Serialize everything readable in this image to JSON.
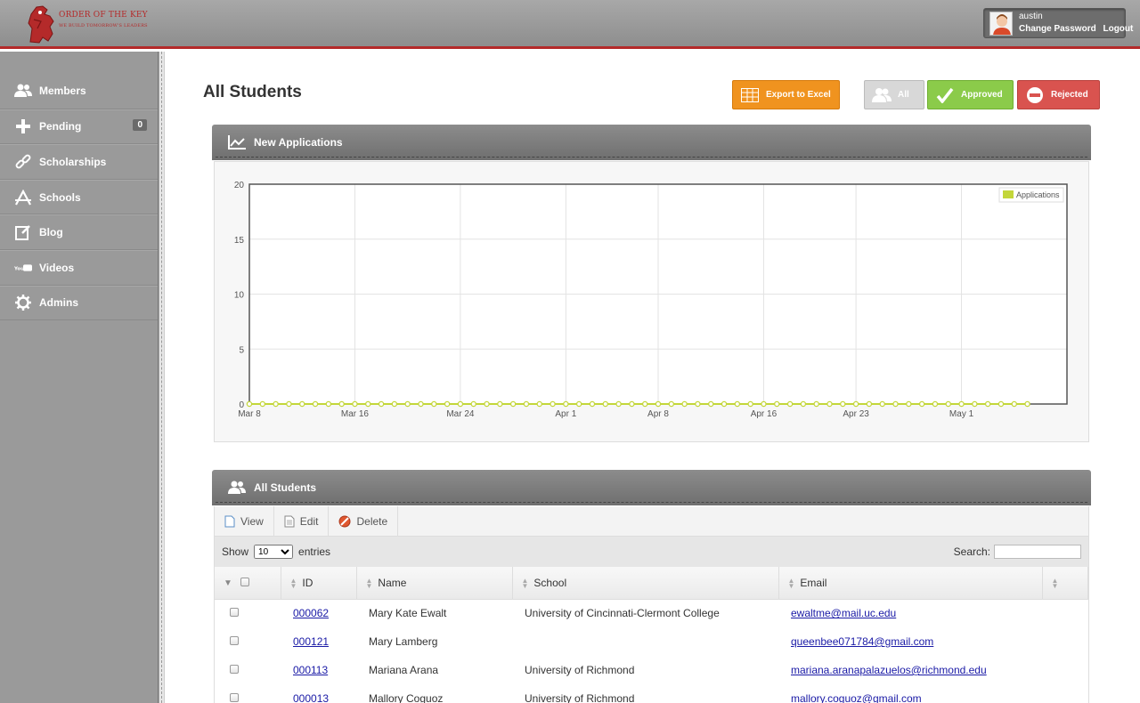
{
  "header": {
    "brand": "ORDER OF THE KEY",
    "tagline": "WE BUILD TOMORROW'S LEADERS",
    "username": "austin",
    "change_password": "Change Password",
    "logout": "Logout"
  },
  "sidebar": {
    "items": [
      {
        "label": "Members",
        "icon": "users-icon"
      },
      {
        "label": "Pending",
        "icon": "plus-icon",
        "badge": "0"
      },
      {
        "label": "Scholarships",
        "icon": "link-icon"
      },
      {
        "label": "Schools",
        "icon": "app-store-icon"
      },
      {
        "label": "Blog",
        "icon": "edit-icon"
      },
      {
        "label": "Videos",
        "icon": "youtube-icon"
      },
      {
        "label": "Admins",
        "icon": "gear-icon"
      }
    ]
  },
  "main": {
    "title": "All Students",
    "buttons": {
      "export": "Export to Excel",
      "all": "All",
      "approved": "Approved",
      "rejected": "Rejected"
    },
    "chart_panel_title": "New Applications",
    "table_panel_title": "All Students"
  },
  "colors": {
    "accent_red": "#b42a2a",
    "export_orange": "#f0931f",
    "approved_green": "#8bcb4a",
    "rejected_red": "#d9534f",
    "series_color": "#c3d63a"
  },
  "chart_data": {
    "type": "line",
    "title": "",
    "xlabel": "",
    "ylabel": "",
    "ylim": [
      0,
      20
    ],
    "yticks": [
      0,
      5,
      10,
      15,
      20
    ],
    "xticks": [
      "Mar 8",
      "Mar 16",
      "Mar 24",
      "Apr 1",
      "Apr 8",
      "Apr 16",
      "Apr 23",
      "May 1"
    ],
    "xlim": [
      "2015-03-08",
      "2015-05-09"
    ],
    "series": [
      {
        "name": "Applications",
        "color": "#c3d63a",
        "x": [
          "2015-03-08",
          "2015-03-09",
          "2015-03-10",
          "2015-03-11",
          "2015-03-12",
          "2015-03-13",
          "2015-03-14",
          "2015-03-15",
          "2015-03-16",
          "2015-03-17",
          "2015-03-18",
          "2015-03-19",
          "2015-03-20",
          "2015-03-21",
          "2015-03-22",
          "2015-03-23",
          "2015-03-24",
          "2015-03-25",
          "2015-03-26",
          "2015-03-27",
          "2015-03-28",
          "2015-03-29",
          "2015-03-30",
          "2015-03-31",
          "2015-04-01",
          "2015-04-02",
          "2015-04-03",
          "2015-04-04",
          "2015-04-05",
          "2015-04-06",
          "2015-04-07",
          "2015-04-08",
          "2015-04-09",
          "2015-04-10",
          "2015-04-11",
          "2015-04-12",
          "2015-04-13",
          "2015-04-14",
          "2015-04-15",
          "2015-04-16",
          "2015-04-17",
          "2015-04-18",
          "2015-04-19",
          "2015-04-20",
          "2015-04-21",
          "2015-04-22",
          "2015-04-23",
          "2015-04-24",
          "2015-04-25",
          "2015-04-26",
          "2015-04-27",
          "2015-04-28",
          "2015-04-29",
          "2015-04-30",
          "2015-05-01",
          "2015-05-02",
          "2015-05-03",
          "2015-05-04",
          "2015-05-05",
          "2015-05-06"
        ],
        "values": [
          0,
          0,
          0,
          0,
          0,
          0,
          0,
          0,
          0,
          0,
          0,
          0,
          0,
          0,
          0,
          0,
          0,
          0,
          0,
          0,
          0,
          0,
          0,
          0,
          0,
          0,
          0,
          0,
          0,
          0,
          0,
          0,
          0,
          0,
          0,
          0,
          0,
          0,
          0,
          0,
          0,
          0,
          0,
          0,
          0,
          0,
          0,
          0,
          0,
          0,
          0,
          0,
          0,
          0,
          0,
          0,
          0,
          0,
          0,
          0
        ]
      }
    ],
    "grid": true,
    "legend": "top-right"
  },
  "table": {
    "toolbar": {
      "view": "View",
      "edit": "Edit",
      "delete": "Delete"
    },
    "show_label": "Show",
    "entries_value": "10",
    "entries_label": "entries",
    "search_label": "Search:",
    "columns": [
      "ID",
      "Name",
      "School",
      "Email"
    ],
    "rows": [
      {
        "id": "000062",
        "name": "Mary Kate Ewalt",
        "school": "University of Cincinnati-Clermont College",
        "email": "ewaltme@mail.uc.edu"
      },
      {
        "id": "000121",
        "name": "Mary Lamberg",
        "school": "",
        "email": "queenbee071784@gmail.com"
      },
      {
        "id": "000113",
        "name": "Mariana Arana",
        "school": "University of Richmond",
        "email": "mariana.aranapalazuelos@richmond.edu"
      },
      {
        "id": "000013",
        "name": "Mallory Coguoz",
        "school": "University of Richmond",
        "email": "mallory.coguoz@gmail.com"
      }
    ]
  }
}
